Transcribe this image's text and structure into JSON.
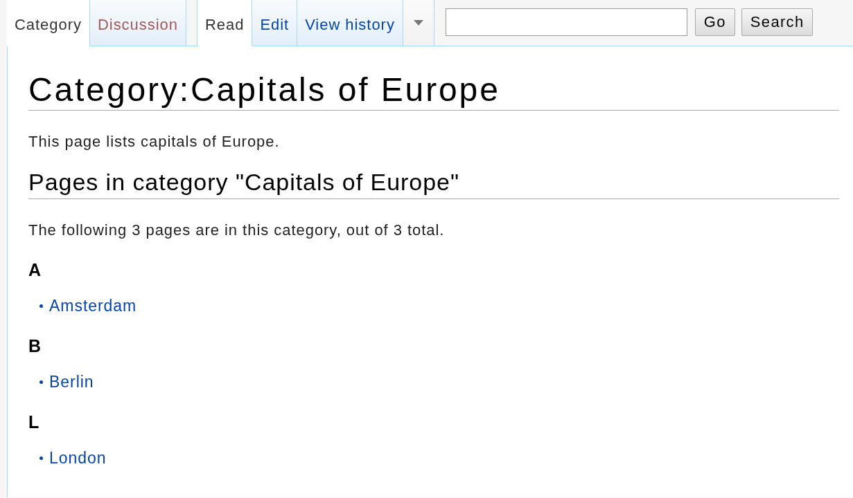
{
  "namespace_tabs": [
    {
      "label": "Category",
      "selected": true,
      "redlink": false
    },
    {
      "label": "Discussion",
      "selected": false,
      "redlink": true
    }
  ],
  "view_tabs": [
    {
      "label": "Read",
      "selected": true,
      "redlink": false
    },
    {
      "label": "Edit",
      "selected": false,
      "redlink": false
    },
    {
      "label": "View history",
      "selected": false,
      "redlink": false
    }
  ],
  "search": {
    "go_button": "Go",
    "search_button": "Search"
  },
  "title": "Category:Capitals of Europe",
  "intro": "This page lists capitals of Europe.",
  "section_heading": "Pages in category \"Capitals of Europe\"",
  "count_text": "The following 3 pages are in this category, out of 3 total.",
  "groups": [
    {
      "letter": "A",
      "pages": [
        "Amsterdam"
      ]
    },
    {
      "letter": "B",
      "pages": [
        "Berlin"
      ]
    },
    {
      "letter": "L",
      "pages": [
        "London"
      ]
    }
  ]
}
